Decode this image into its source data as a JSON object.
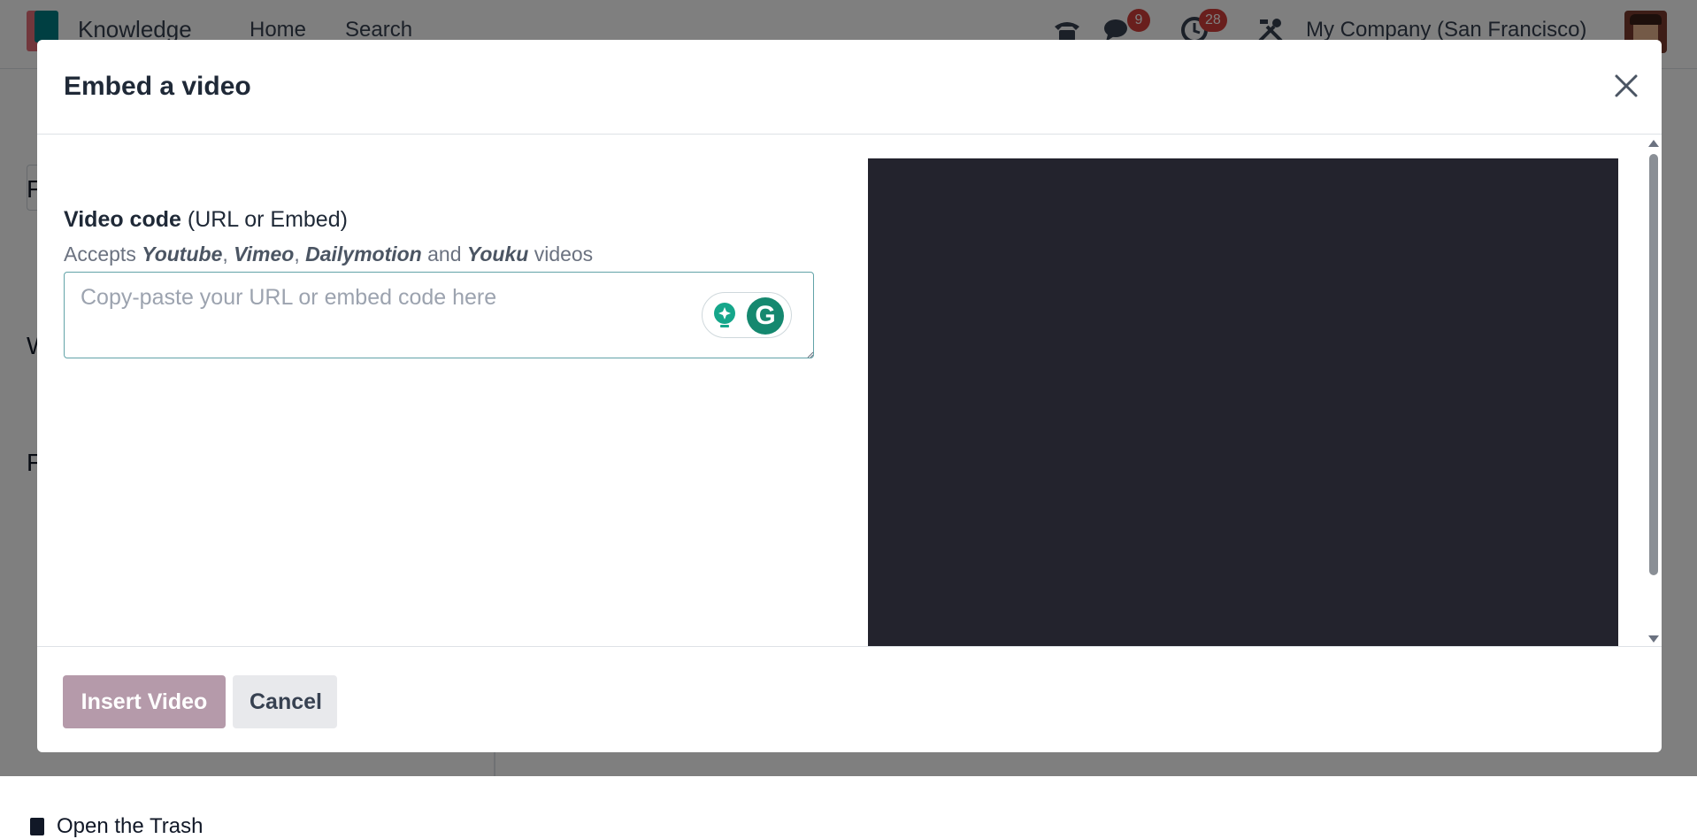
{
  "navbar": {
    "app_title": "Knowledge",
    "menu": [
      "Home",
      "Search"
    ],
    "messages_count": "9",
    "activities_count": "28",
    "company": "My Company (San Francisco)"
  },
  "sidebar": {
    "letters": [
      "F",
      "W",
      "F"
    ],
    "trash_label": "Open the Trash"
  },
  "dialog": {
    "title": "Embed a video",
    "field_label_bold": "Video code",
    "field_label_rest": " (URL or Embed)",
    "help_prefix": "Accepts ",
    "help_sources": [
      "Youtube",
      "Vimeo",
      "Dailymotion",
      "Youku"
    ],
    "help_sep1": ", ",
    "help_sep2": ", ",
    "help_and": " and ",
    "help_suffix": " videos",
    "input_value": "",
    "input_placeholder": "Copy-paste your URL or embed code here",
    "insert_button": "Insert Video",
    "cancel_button": "Cancel"
  },
  "icons": {
    "phone": "phone-icon",
    "messages": "chat-bubbles-icon",
    "activities": "clock-icon",
    "settings": "tools-icon",
    "close": "close-icon",
    "grammarly_suggest": "lightbulb-icon",
    "grammarly": "grammarly-logo-icon"
  },
  "colors": {
    "primary_button": "#b59aaa",
    "badge": "#d23f3a",
    "input_focus_border": "#62a3a8",
    "video_preview": "#23232d"
  }
}
